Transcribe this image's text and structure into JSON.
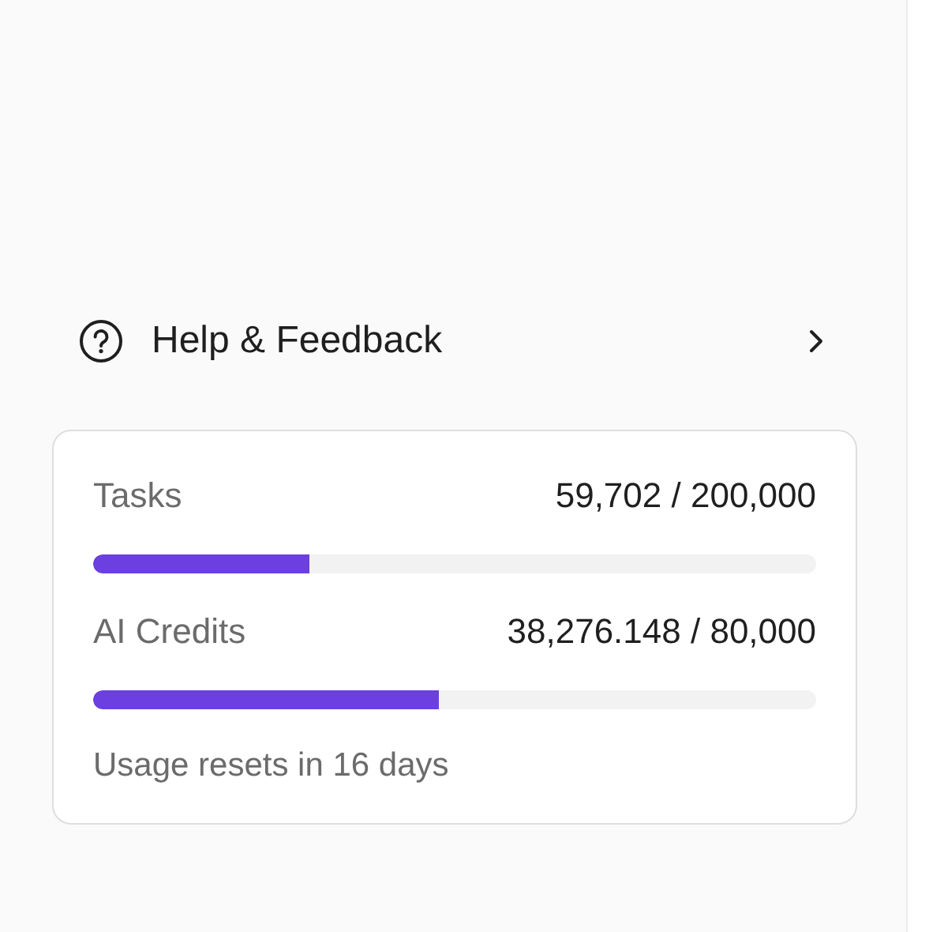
{
  "help_link": {
    "label": "Help & Feedback"
  },
  "usage": {
    "meters": [
      {
        "name": "Tasks",
        "reading": "59,702 / 200,000",
        "level": 0.2985
      },
      {
        "name": "AI Credits",
        "reading": "38,276.148 / 80,000",
        "level": 0.4785
      }
    ],
    "note": "Usage resets in 16 days"
  }
}
